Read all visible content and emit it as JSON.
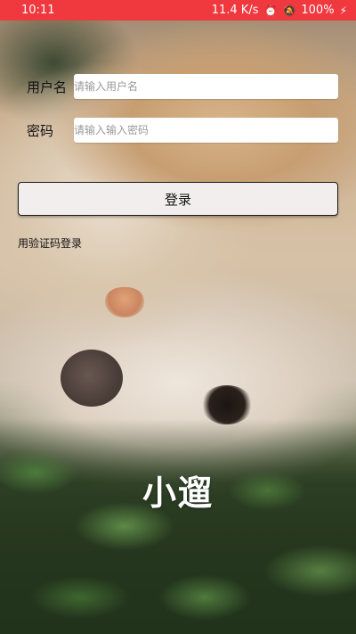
{
  "status_bar": {
    "time": "10:11",
    "network_speed": "11.4 K/s",
    "battery": "100%",
    "alarm_icon": "alarm-clock-icon",
    "mute_icon": "notifications-off-icon",
    "charging_icon": "lightning-icon",
    "background_color": "#f0383f"
  },
  "form": {
    "username_label": "用户名",
    "username_placeholder": "请输入用户名",
    "username_value": "",
    "password_label": "密码",
    "password_placeholder": "请输入输入密码",
    "password_value": ""
  },
  "actions": {
    "login_label": "登录",
    "code_login_link": "用验证码登录"
  },
  "app_title": "小遛"
}
